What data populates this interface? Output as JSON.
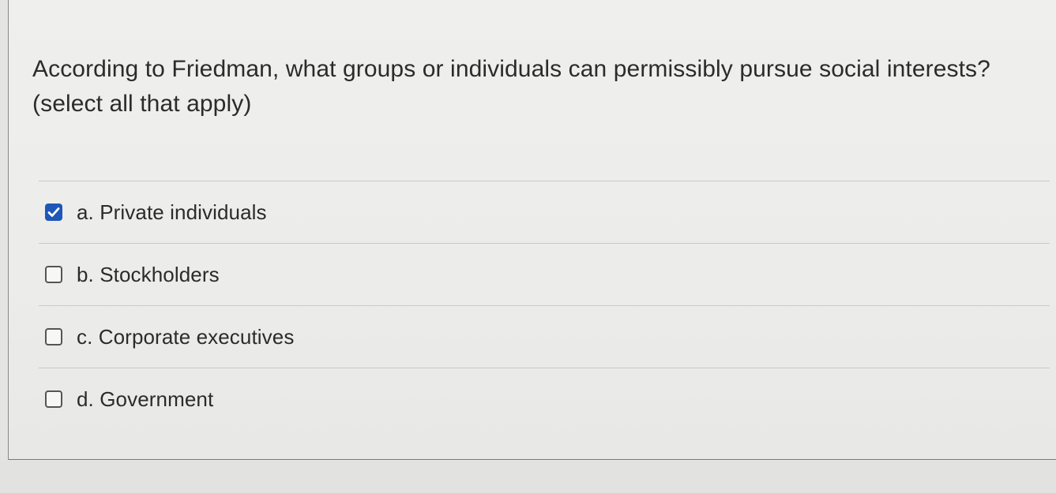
{
  "question": {
    "line1": "According to Friedman, what groups or individuals can permissibly pursue social interests?",
    "line2": "(select all that apply)"
  },
  "options": [
    {
      "label": "a. Private individuals",
      "checked": true
    },
    {
      "label": "b. Stockholders",
      "checked": false
    },
    {
      "label": "c. Corporate executives",
      "checked": false
    },
    {
      "label": "d. Government",
      "checked": false
    }
  ],
  "colors": {
    "checkbox_checked": "#1f57b8",
    "background": "#ececea"
  },
  "icons": {
    "checked": "checkmark-icon"
  }
}
